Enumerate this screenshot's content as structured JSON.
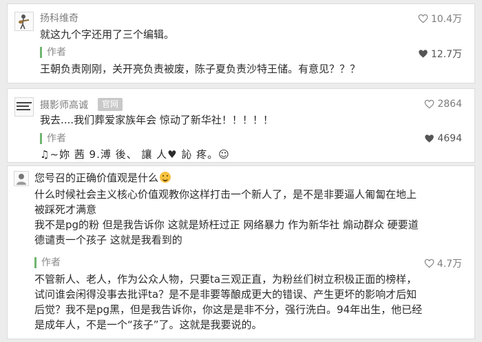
{
  "comments": [
    {
      "author": "扬科维奇",
      "likes": "10.4万",
      "text": "就这九个字还用了三个编辑。",
      "reply": {
        "label": "作者",
        "likes": "12.7万",
        "text": "王朝负责刚刚，关开亮负责被废，陈子夏负责沙特王储。有意见？？？"
      }
    },
    {
      "author": "摄影师高诚",
      "badge": "官网",
      "likes": "2864",
      "text": "我去....我们葬爱家族年会 惊动了新华社！！！！！",
      "reply": {
        "label": "作者",
        "likes": "4694",
        "text": "♫~妳 茜 9.溥 後、 讓 人♥ 訫 疼。☺"
      }
    },
    {
      "text_lines": [
        "您号召的正确价值观是什么",
        "什么时候社会主义核心价值观教你这样打击一个新人了，是不是非要逼人匍匐在地上",
        "被踩死才满意",
        "我不是pg的粉 但是我告诉你 这就是矫枉过正 网络暴力 作为新华社 煽动群众 硬要道",
        "德谴责一个孩子 这就是我看到的"
      ],
      "reply": {
        "label": "作者",
        "likes": "4.7万",
        "text_lines": [
          "不管新人、老人，作为公众人物，只要ta三观正直，为粉丝们树立积极正面的榜样，",
          "试问谁会闲得没事去批评ta？是不是非要等酿成更大的错误、产生更坏的影响才后知",
          "后觉？我不是pg黑，但是我告诉你，你这是是非不分，强行洗白。94年出生，他已经",
          "是成年人，不是一个“孩子”了。这就是我要说的。"
        ]
      }
    }
  ],
  "colors": {
    "reply_bar": "#6fb56f",
    "liked_heart": "#555555"
  }
}
